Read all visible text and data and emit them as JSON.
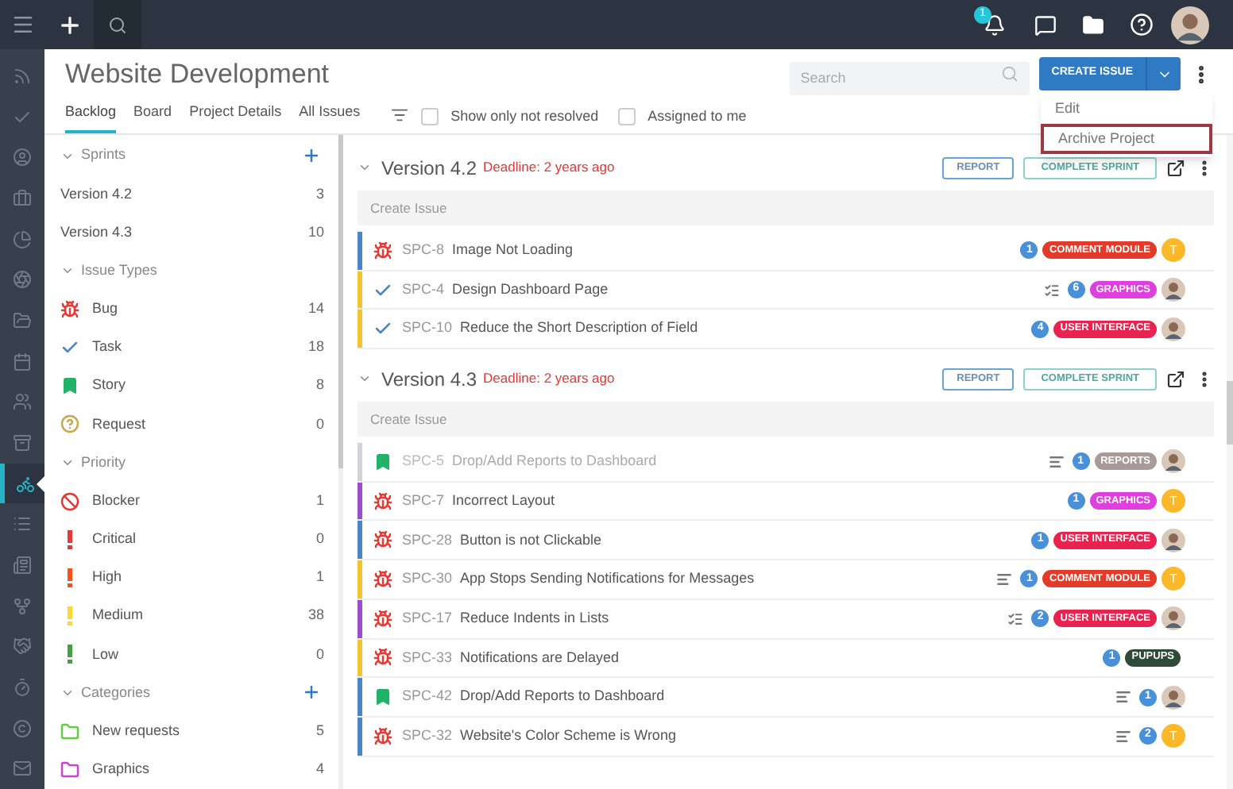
{
  "topbar": {
    "notification_count": "1"
  },
  "nav_items": [
    {
      "selected": false
    },
    {
      "selected": false
    },
    {
      "selected": false
    },
    {
      "selected": false
    },
    {
      "selected": false
    },
    {
      "selected": false
    },
    {
      "selected": false
    },
    {
      "selected": false
    },
    {
      "selected": false
    },
    {
      "selected": false
    },
    {
      "selected": true
    },
    {
      "selected": false
    },
    {
      "selected": false
    },
    {
      "selected": false
    },
    {
      "selected": false
    },
    {
      "selected": false
    },
    {
      "selected": false
    },
    {
      "selected": false
    }
  ],
  "project": {
    "title": "Website Development",
    "tabs": [
      {
        "label": "Backlog",
        "selected": true
      },
      {
        "label": "Board",
        "selected": false
      },
      {
        "label": "Project Details",
        "selected": false
      },
      {
        "label": "All Issues",
        "selected": false
      }
    ],
    "filters": [
      {
        "label": "Show only not resolved",
        "checked": false
      },
      {
        "label": "Assigned to me",
        "checked": false
      }
    ],
    "search": {
      "placeholder": "Search"
    },
    "create_button": "CREATE ISSUE",
    "menu": [
      {
        "label": "Edit",
        "focused": false
      },
      {
        "label": "Archive Project",
        "focused": true
      }
    ]
  },
  "sidebar": [
    {
      "title": "Sprints",
      "expanded": true,
      "add": true,
      "items": [
        {
          "label": "Version 4.2",
          "count": "3"
        },
        {
          "label": "Version 4.3",
          "count": "10"
        }
      ]
    },
    {
      "title": "Issue Types",
      "expanded": true,
      "add": false,
      "items": [
        {
          "kind": "bug",
          "label": "Bug",
          "count": "14"
        },
        {
          "kind": "task",
          "label": "Task",
          "count": "18"
        },
        {
          "kind": "story",
          "label": "Story",
          "count": "8"
        },
        {
          "kind": "request",
          "label": "Request",
          "count": "0"
        }
      ]
    },
    {
      "title": "Priority",
      "expanded": true,
      "add": false,
      "items": [
        {
          "kind": "blocker",
          "label": "Blocker",
          "count": "1"
        },
        {
          "kind": "priority",
          "color": "#e53935",
          "label": "Critical",
          "count": "0"
        },
        {
          "kind": "priority",
          "color": "#f4511e",
          "label": "High",
          "count": "1"
        },
        {
          "kind": "priority",
          "color": "#fdd835",
          "label": "Medium",
          "count": "38"
        },
        {
          "kind": "priority",
          "color": "#43a047",
          "label": "Low",
          "count": "0"
        }
      ]
    },
    {
      "title": "Categories",
      "expanded": true,
      "add": true,
      "items": [
        {
          "kind": "folder",
          "color": "#66cc44",
          "label": "New requests",
          "count": "5"
        },
        {
          "kind": "folder",
          "color": "#cc44cc",
          "label": "Graphics",
          "count": "4"
        }
      ]
    }
  ],
  "sprints": [
    {
      "title": "Version 4.2",
      "deadline": "Deadline: 2 years ago",
      "expanded": true,
      "report_button": "REPORT",
      "complete_button": "COMPLETE SPRINT",
      "create_placeholder": "Create Issue",
      "issues": [
        {
          "kind": "bug",
          "key": "SPC-8",
          "title": "Image Not Loading",
          "color": "#4a86c8",
          "resolved": false,
          "count": "1",
          "tag": {
            "label": "COMMENT MODULE",
            "color": "#e23b2a"
          },
          "assignee": {
            "kind": "letter",
            "letter": "T"
          }
        },
        {
          "kind": "task",
          "key": "SPC-4",
          "title": "Design Dashboard Page",
          "color": "#f4c430",
          "resolved": false,
          "note": {
            "kind": "checklist"
          },
          "count": "6",
          "tag": {
            "label": "GRAPHICS",
            "color": "#e03fe0"
          },
          "assignee": {
            "kind": "photo"
          }
        },
        {
          "kind": "task",
          "key": "SPC-10",
          "title": "Reduce the Short Description of Field",
          "color": "#f4c430",
          "resolved": false,
          "count": "4",
          "tag": {
            "label": "USER INTERFACE",
            "color": "#e8234f"
          },
          "assignee": {
            "kind": "photo"
          }
        }
      ]
    },
    {
      "title": "Version 4.3",
      "deadline": "Deadline: 2 years ago",
      "expanded": true,
      "report_button": "REPORT",
      "complete_button": "COMPLETE SPRINT",
      "create_placeholder": "Create Issue",
      "issues": [
        {
          "kind": "story",
          "key": "SPC-5",
          "title": "Drop/Add Reports to Dashboard",
          "color": "#d0d4d8",
          "resolved": true,
          "note": {
            "kind": "text"
          },
          "count": "1",
          "tag": {
            "label": "REPORTS",
            "color": "#a89a98"
          },
          "assignee": {
            "kind": "photo"
          }
        },
        {
          "kind": "bug",
          "key": "SPC-7",
          "title": "Incorrect Layout",
          "color": "#9b4dca",
          "resolved": false,
          "count": "1",
          "tag": {
            "label": "GRAPHICS",
            "color": "#e03fe0"
          },
          "assignee": {
            "kind": "letter",
            "letter": "T"
          }
        },
        {
          "kind": "bug",
          "key": "SPC-28",
          "title": "Button is not Clickable",
          "color": "#4a86c8",
          "resolved": false,
          "count": "1",
          "tag": {
            "label": "USER INTERFACE",
            "color": "#e8234f"
          },
          "assignee": {
            "kind": "photo"
          }
        },
        {
          "kind": "bug",
          "key": "SPC-30",
          "title": "App Stops Sending Notifications for Messages",
          "color": "#f4c430",
          "resolved": false,
          "note": {
            "kind": "text"
          },
          "count": "1",
          "tag": {
            "label": "COMMENT MODULE",
            "color": "#e23b2a"
          },
          "assignee": {
            "kind": "letter",
            "letter": "T"
          }
        },
        {
          "kind": "bug",
          "key": "SPC-17",
          "title": "Reduce Indents in Lists",
          "color": "#9b4dca",
          "resolved": false,
          "note": {
            "kind": "checklist"
          },
          "count": "2",
          "tag": {
            "label": "USER INTERFACE",
            "color": "#e8234f"
          },
          "assignee": {
            "kind": "photo"
          }
        },
        {
          "kind": "bug",
          "key": "SPC-33",
          "title": "Notifications are Delayed",
          "color": "#f4c430",
          "resolved": false,
          "count": "1",
          "tag": {
            "label": "PUPUPS",
            "color": "#2f4a36"
          }
        },
        {
          "kind": "story",
          "key": "SPC-42",
          "title": "Drop/Add Reports to Dashboard",
          "color": "#4a86c8",
          "resolved": false,
          "note": {
            "kind": "text"
          },
          "count": "1",
          "assignee": {
            "kind": "photo"
          }
        },
        {
          "kind": "bug",
          "key": "SPC-32",
          "title": "Website's Color Scheme is Wrong",
          "color": "#4a86c8",
          "resolved": false,
          "note": {
            "kind": "text"
          },
          "count": "2",
          "assignee": {
            "kind": "letter",
            "letter": "T"
          }
        }
      ]
    }
  ]
}
